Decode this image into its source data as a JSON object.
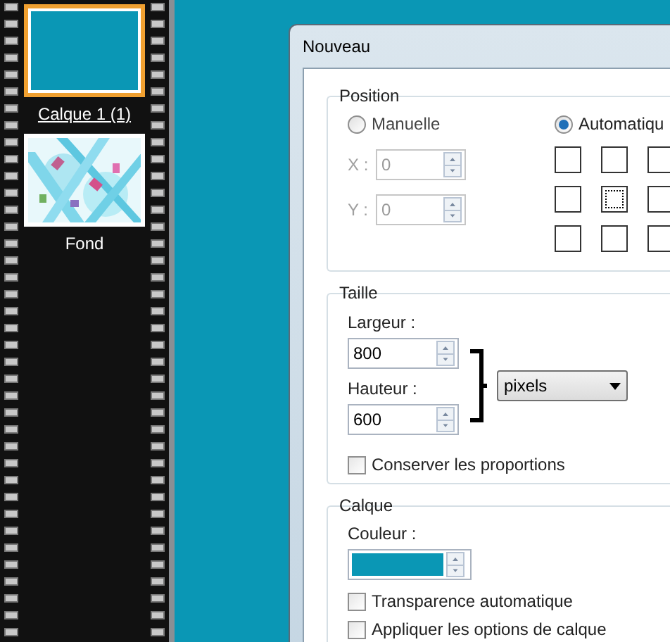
{
  "layers": [
    {
      "name": "Calque 1 (1)",
      "selected": true,
      "kind": "fill"
    },
    {
      "name": "Fond",
      "selected": false,
      "kind": "picture"
    }
  ],
  "dialog": {
    "title": "Nouveau",
    "position": {
      "title": "Position",
      "modes": [
        {
          "label": "Manuelle",
          "selected": false
        },
        {
          "label": "Automatiqu",
          "selected": true
        }
      ],
      "fields": [
        {
          "label": "X :",
          "value": "0",
          "disabled": true
        },
        {
          "label": "Y :",
          "value": "0",
          "disabled": true
        }
      ],
      "anchors": [
        {
          "selected": false
        },
        {
          "selected": false
        },
        {
          "selected": false
        },
        {
          "selected": false
        },
        {
          "selected": true
        },
        {
          "selected": false
        },
        {
          "selected": false
        },
        {
          "selected": false
        },
        {
          "selected": false
        }
      ]
    },
    "size": {
      "title": "Taille",
      "fields": [
        {
          "label": "Largeur :",
          "value": "800"
        },
        {
          "label": "Hauteur :",
          "value": "600"
        }
      ],
      "unit": "pixels",
      "options": [
        {
          "label": "Conserver les proportions",
          "checked": false
        }
      ]
    },
    "layer": {
      "title": "Calque",
      "color_label": "Couleur :",
      "options": [
        {
          "label": "Transparence automatique",
          "checked": false
        },
        {
          "label": "Appliquer les options de calque",
          "checked": false
        }
      ]
    }
  }
}
